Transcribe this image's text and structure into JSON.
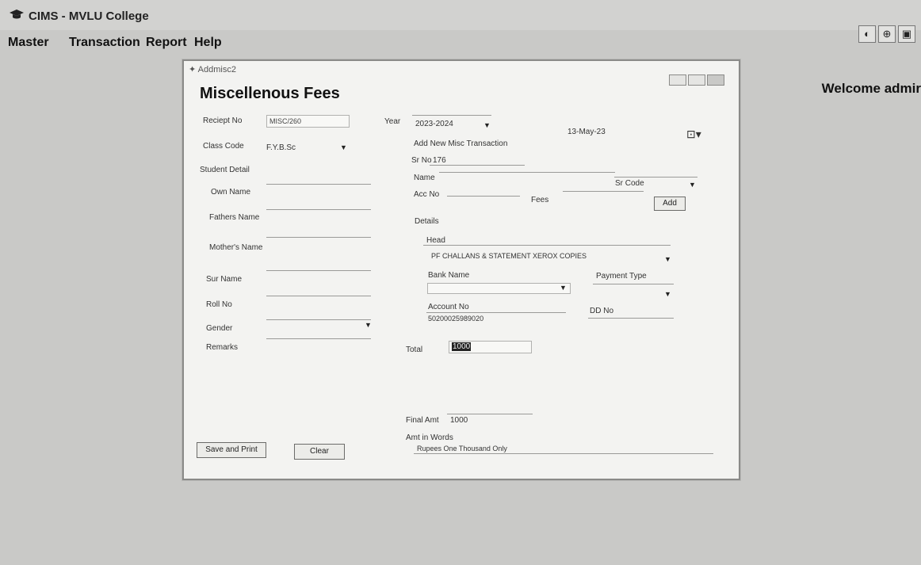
{
  "app": {
    "title": "CIMS - MVLU College",
    "menu": [
      "Master",
      "Transaction",
      "Report",
      "Help"
    ],
    "icons": [
      "contrast-icon",
      "refresh-icon",
      "image-icon"
    ],
    "welcome": "Welcome admir"
  },
  "window": {
    "title": "Addmisc2",
    "heading": "Miscellenous Fees",
    "receipt": {
      "label": "Reciept No",
      "value": "MISC/260"
    },
    "class": {
      "label": "Class Code",
      "value": "F.Y.B.Sc"
    },
    "student_detail": "Student Detail",
    "own_name": "Own Name",
    "fathers_name": "Fathers Name",
    "mothers_name": "Mother's Name",
    "sur_name": "Sur Name",
    "roll_no": "Roll No",
    "gender": "Gender",
    "remarks": "Remarks",
    "year": {
      "label": "Year",
      "value": "2023-2024"
    },
    "date": "13-May-23",
    "add_new": "Add New Misc Transaction",
    "sr_no": {
      "label": "Sr No",
      "value": "176"
    },
    "name": "Name",
    "sr_code": "Sr Code",
    "acc_no": "Acc No",
    "fees": "Fees",
    "add_button": "Add",
    "details": "Details",
    "head": {
      "label": "Head",
      "value": "PF CHALLANS & STATEMENT XEROX COPIES"
    },
    "bank_name": "Bank Name",
    "payment_type": "Payment Type",
    "account_no": {
      "label": "Account No",
      "value": "50200025989020"
    },
    "dd_no": "DD No",
    "total": {
      "label": "Total",
      "value": "1000"
    },
    "final_amt": {
      "label": "Final Amt",
      "value": "1000"
    },
    "amt_words": {
      "label": "Amt in Words",
      "value": "Rupees One Thousand  Only"
    },
    "save_print": "Save and Print",
    "clear": "Clear"
  }
}
